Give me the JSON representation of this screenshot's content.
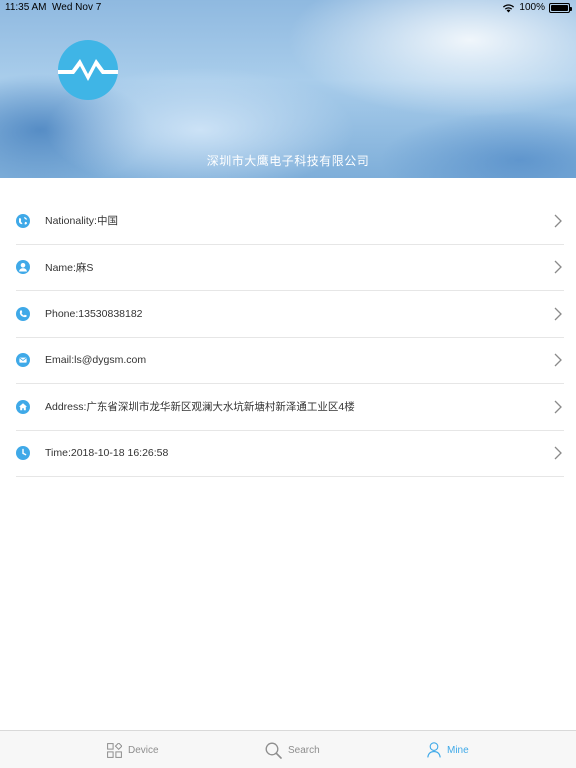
{
  "status_bar": {
    "time": "11:35 AM",
    "date": "Wed Nov 7",
    "battery": "100%",
    "icons": [
      "wifi-icon",
      "battery-icon"
    ]
  },
  "header": {
    "logo": "company-logo",
    "company_name": "深圳市大鹰电子科技有限公司"
  },
  "info_list": [
    {
      "icon": "globe-icon",
      "label": "Nationality:中国"
    },
    {
      "icon": "person-icon",
      "label": "Name:麻S"
    },
    {
      "icon": "phone-icon",
      "label": "Phone:13530838182"
    },
    {
      "icon": "mail-icon",
      "label": "Email:ls@dygsm.com"
    },
    {
      "icon": "home-icon",
      "label": "Address:广东省深圳市龙华新区观澜大水坑新塘村新泽通工业区4楼"
    },
    {
      "icon": "clock-icon",
      "label": "Time:2018-10-18 16:26:58"
    }
  ],
  "tabbar": {
    "tabs": [
      {
        "icon": "device-grid-icon",
        "label": "Device"
      },
      {
        "icon": "search-icon",
        "label": "Search"
      },
      {
        "icon": "person-outline-icon",
        "label": "Mine",
        "active": true
      }
    ]
  },
  "colors": {
    "accent": "#3fa9e8",
    "icon_blue": "#3fa9e8",
    "tab_inactive": "#8e8e8e"
  }
}
